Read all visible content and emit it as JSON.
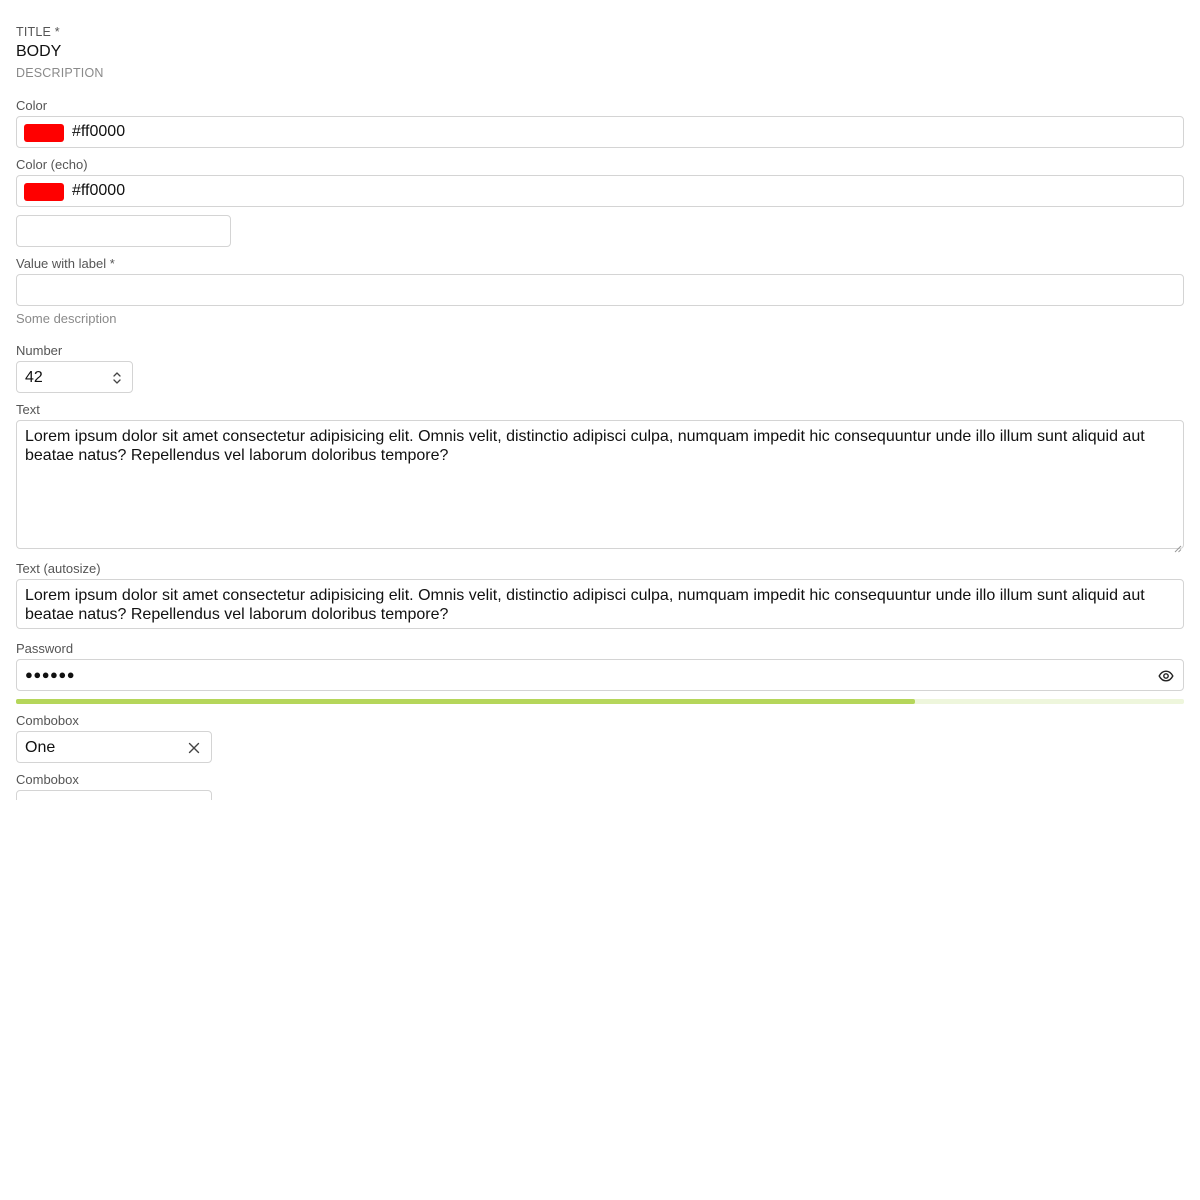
{
  "header": {
    "title": "TITLE *",
    "body": "BODY",
    "description": "DESCRIPTION"
  },
  "color_field": {
    "label": "Color",
    "value": "#ff0000",
    "swatch_color": "#ff0000"
  },
  "color_echo_field": {
    "label": "Color (echo)",
    "value": "#ff0000",
    "swatch_color": "#ff0000"
  },
  "unlabeled_input": {
    "value": ""
  },
  "value_with_label_field": {
    "label": "Value with label *",
    "value": "",
    "description": "Some description"
  },
  "number_field": {
    "label": "Number",
    "value": "42"
  },
  "text_field": {
    "label": "Text",
    "value": "Lorem ipsum dolor sit amet consectetur adipisicing elit. Omnis velit, distinctio adipisci culpa, numquam impedit hic consequuntur unde illo illum sunt aliquid aut beatae natus? Repellendus vel laborum doloribus tempore?"
  },
  "text_autosize_field": {
    "label": "Text (autosize)",
    "value": "Lorem ipsum dolor sit amet consectetur adipisicing elit. Omnis velit, distinctio adipisci culpa, numquam impedit hic consequuntur unde illo illum sunt aliquid aut beatae natus? Repellendus vel laborum doloribus tempore?"
  },
  "password_field": {
    "label": "Password",
    "masked_value": "●●●●●●",
    "strength_fraction": 0.77,
    "strength_color": "#b5d65a",
    "strength_track_color": "#eef6dc"
  },
  "combobox_1": {
    "label": "Combobox",
    "value": "One"
  },
  "combobox_2": {
    "label": "Combobox"
  },
  "icons": {
    "number_spinner": "chevron-up-down-icon",
    "password_toggle": "eye-icon",
    "combobox_clear": "close-icon"
  }
}
